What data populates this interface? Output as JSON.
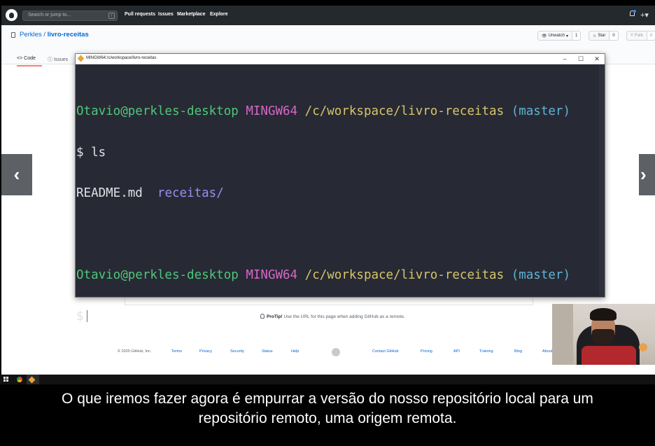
{
  "github": {
    "search_placeholder": "Search or jump to...",
    "search_key": "/",
    "nav": [
      "Pull requests",
      "Issues",
      "Marketplace",
      "Explore"
    ],
    "repo_owner": "Perkles",
    "repo_separator": "/",
    "repo_name": "livro-receitas",
    "watch_label": "Unwatch",
    "watch_count": "1",
    "star_label": "Star",
    "star_count": "0",
    "fork_label": "Fork",
    "fork_count": "0",
    "tab_code": "Code",
    "tab_issues": "Issues",
    "protip_bold": "ProTip!",
    "protip_text": " Use the URL for this page when adding GitHub as a remote.",
    "footer": {
      "copyright": "© 2020 GitHub, Inc.",
      "links": [
        "Terms",
        "Privacy",
        "Security",
        "Status",
        "Help",
        "Contact GitHub",
        "Pricing",
        "API",
        "Training",
        "Blog",
        "About"
      ]
    }
  },
  "terminal": {
    "title": "MINGW64:/c/workspace/livro-receitas",
    "user_host": "Otavio@perkles-desktop",
    "shell": "MINGW64",
    "path": "/c/workspace/livro-receitas",
    "branch": "(master)",
    "cmd1": "$ ls",
    "ls_file": "README.md",
    "ls_dir": "receitas/",
    "prompt": "$"
  },
  "subtitle": {
    "line1": "O que iremos fazer agora é empurrar a versão do nosso repositório local para um",
    "line2": "repositório remoto, uma origem remota."
  },
  "icons": {
    "arrow_left": "chevron-left-icon",
    "arrow_right": "chevron-right-icon"
  }
}
